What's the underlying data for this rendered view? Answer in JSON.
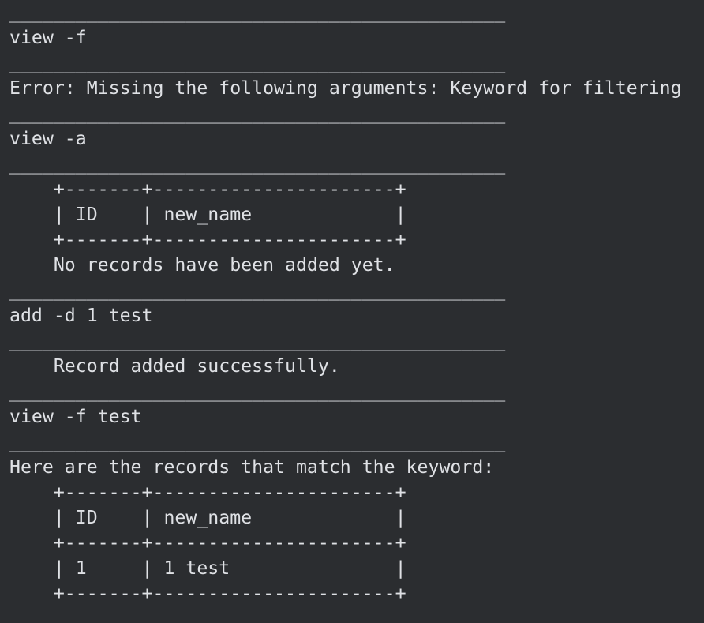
{
  "console": {
    "separator": "_____________________________________________",
    "lines": [
      "view -f",
      "Error: Missing the following arguments: Keyword for filtering",
      "view -a",
      "    +-------+----------------------+",
      "    | ID    | new_name             |",
      "    +-------+----------------------+",
      "    No records have been added yet.",
      "add -d 1 test",
      "    Record added successfully.",
      "view -f test",
      "Here are the records that match the keyword:",
      "    +-------+----------------------+",
      "    | ID    | new_name             |",
      "    +-------+----------------------+",
      "    | 1     | 1 test               |",
      "    +-------+----------------------+"
    ]
  }
}
